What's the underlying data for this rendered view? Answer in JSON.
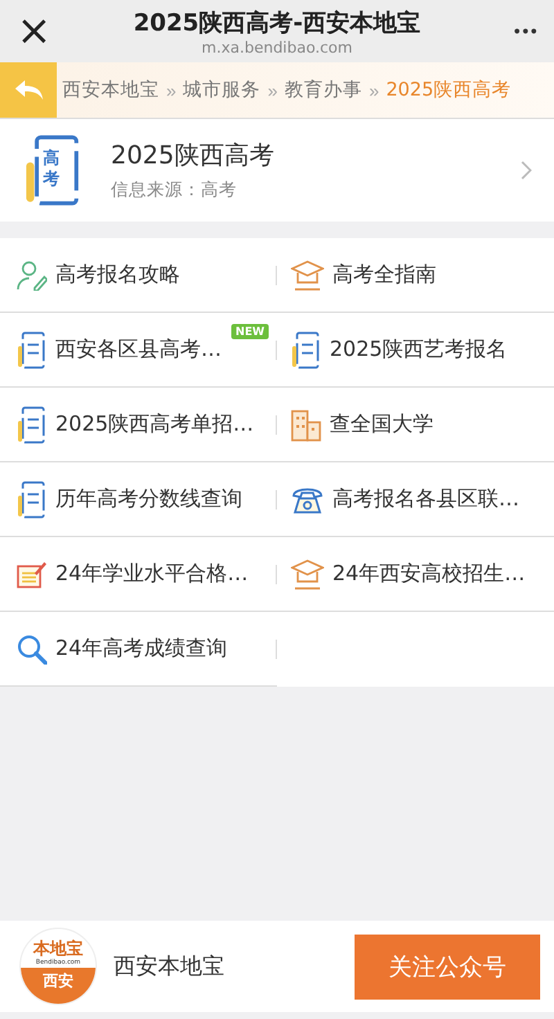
{
  "title_bar": {
    "title": "2025陕西高考-西安本地宝",
    "url": "m.xa.bendibao.com",
    "close": "×",
    "more": "•••"
  },
  "breadcrumb": [
    {
      "label": "西安本地宝",
      "selected": false
    },
    {
      "label": "城市服务",
      "selected": false
    },
    {
      "label": "教育办事",
      "selected": false
    },
    {
      "label": "2025陕西高考",
      "selected": true
    }
  ],
  "breadcrumb_separator": "»",
  "header": {
    "icon_text": "高考",
    "title": "2025陕西高考",
    "source": "信息来源：高考"
  },
  "links": [
    {
      "kind": "person",
      "label": "高考报名攻略"
    },
    {
      "kind": "cap",
      "label": "高考全指南"
    },
    {
      "kind": "card",
      "label": "西安各区县高考…",
      "badge": "NEW"
    },
    {
      "kind": "card",
      "label": "2025陕西艺考报名"
    },
    {
      "kind": "card",
      "label": "2025陕西高考单招…"
    },
    {
      "kind": "building",
      "label": "查全国大学"
    },
    {
      "kind": "card",
      "label": "历年高考分数线查询"
    },
    {
      "kind": "phone",
      "label": "高考报名各县区联…"
    },
    {
      "kind": "note",
      "label": "24年学业水平合格…"
    },
    {
      "kind": "cap",
      "label": "24年西安高校招生…"
    },
    {
      "kind": "search",
      "label": "24年高考成绩查询"
    }
  ],
  "footer": {
    "logo_top": "本地宝",
    "logo_mid": "Bendibao.com",
    "logo_bottom": "西安",
    "name": "西安本地宝",
    "follow_button": "关注公众号"
  }
}
